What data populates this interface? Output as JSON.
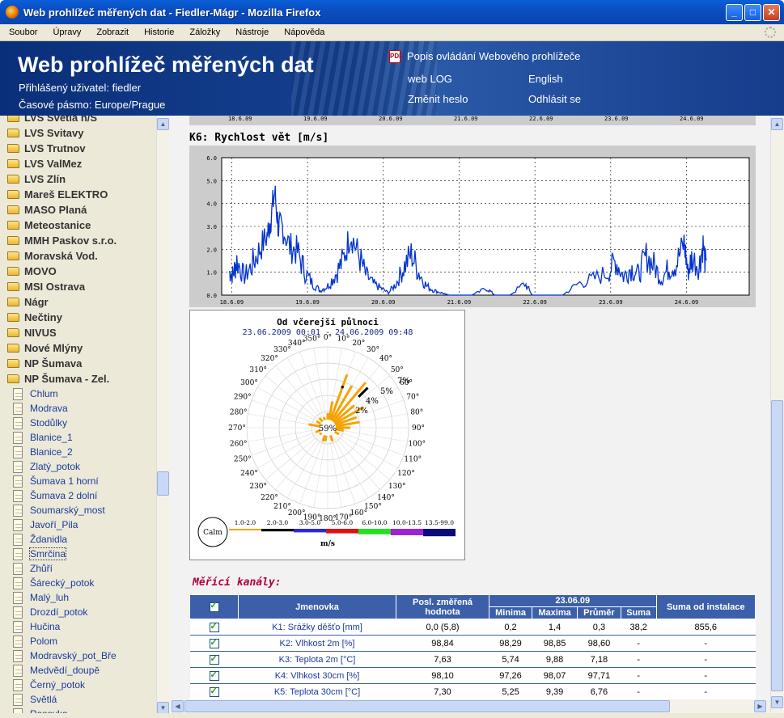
{
  "window": {
    "title": "Web prohlížeč měřených dat - Fiedler-Mágr - Mozilla Firefox"
  },
  "menu": [
    "Soubor",
    "Úpravy",
    "Zobrazit",
    "Historie",
    "Záložky",
    "Nástroje",
    "Nápověda"
  ],
  "header": {
    "title": "Web prohlížeč měřených dat",
    "user": "Přihlášený uživatel: fiedler",
    "timezone": "Časové pásmo: Europe/Prague",
    "pdf_link": "Popis ovládání Webového prohlížeče",
    "weblog": "web LOG",
    "english": "English",
    "change_password": "Změnit heslo",
    "logout": "Odhlásit se"
  },
  "sidebar": {
    "folders": [
      "LVS Světlá n/S",
      "LVS Svitavy",
      "LVS Trutnov",
      "LVS ValMez",
      "LVS Zlín",
      "Mareš ELEKTRO",
      "MASO Planá",
      "Meteostanice",
      "MMH Paskov s.r.o.",
      "Moravská Vod.",
      "MOVO",
      "MSI Ostrava",
      "Nágr",
      "Nečtiny",
      "NIVUS",
      "Nové Mlýny",
      "NP Šumava",
      "NP Šumava - Zel."
    ],
    "stations": [
      "Chlum",
      "Modrava",
      "Stodůlky",
      "Blanice_1",
      "Blanice_2",
      "Zlatý_potok",
      "Šumava 1 horní",
      "Šumava 2 dolní",
      "Soumarský_most",
      "Javoří_Pila",
      "Ždanidla",
      "Smrčina",
      "Zhůří",
      "Šárecký_potok",
      "Malý_luh",
      "Drozdí_potok",
      "Hučina",
      "Polom",
      "Modravský_pot_Bře",
      "Medvědí_doupě",
      "Černý_potok",
      "Světlá",
      "Rasovka"
    ],
    "selected": "Smrčina"
  },
  "chart_data": [
    {
      "type": "line",
      "title": "K6: Rychlost vět [m/s]",
      "x_ticks": [
        "18.6.09",
        "19.6.09",
        "20.6.09",
        "21.6.09",
        "22.6.09",
        "23.6.09",
        "24.6.09"
      ],
      "y_ticks": [
        "0.0",
        "1.0",
        "2.0",
        "3.0",
        "4.0",
        "5.0",
        "6.0"
      ],
      "ylim": [
        0,
        6
      ],
      "grid": true,
      "color": "#0033cc",
      "series": [
        {
          "values": [
            [
              0.0,
              1.0
            ],
            [
              0.05,
              0.9
            ],
            [
              0.1,
              1.5
            ],
            [
              0.2,
              0.8
            ],
            [
              0.3,
              1.3
            ],
            [
              0.4,
              2.0
            ],
            [
              0.5,
              2.6
            ],
            [
              0.55,
              3.4
            ],
            [
              0.6,
              4.5
            ],
            [
              0.65,
              2.9
            ],
            [
              0.7,
              3.0
            ],
            [
              0.8,
              2.1
            ],
            [
              0.9,
              1.9
            ],
            [
              1.0,
              1.0
            ],
            [
              1.1,
              0.5
            ],
            [
              1.2,
              0.2
            ],
            [
              1.3,
              0.4
            ],
            [
              1.4,
              0.9
            ],
            [
              1.5,
              1.5
            ],
            [
              1.6,
              2.7
            ],
            [
              1.7,
              1.8
            ],
            [
              1.8,
              0.9
            ],
            [
              1.9,
              0.5
            ],
            [
              2.0,
              0.3
            ],
            [
              2.1,
              0.1
            ],
            [
              2.2,
              0.5
            ],
            [
              2.3,
              1.2
            ],
            [
              2.4,
              1.8
            ],
            [
              2.5,
              1.0
            ],
            [
              2.6,
              0.4
            ],
            [
              2.7,
              0.2
            ],
            [
              2.8,
              0.1
            ],
            [
              2.9,
              0.0
            ],
            [
              3.0,
              0.0
            ],
            [
              3.2,
              0.0
            ],
            [
              3.4,
              0.3
            ],
            [
              3.5,
              0.0
            ],
            [
              3.7,
              0.0
            ],
            [
              3.9,
              0.5
            ],
            [
              4.0,
              0.0
            ],
            [
              4.2,
              0.0
            ],
            [
              4.4,
              0.0
            ],
            [
              4.6,
              0.5
            ],
            [
              4.8,
              0.7
            ],
            [
              5.0,
              1.0
            ],
            [
              5.1,
              1.5
            ],
            [
              5.2,
              0.8
            ],
            [
              5.3,
              1.2
            ],
            [
              5.4,
              0.9
            ],
            [
              5.5,
              1.7
            ],
            [
              5.6,
              1.3
            ],
            [
              5.7,
              0.7
            ],
            [
              5.8,
              1.2
            ],
            [
              5.9,
              1.4
            ],
            [
              6.0,
              2.3
            ],
            [
              6.05,
              1.0
            ],
            [
              6.1,
              1.6
            ],
            [
              6.2,
              1.3
            ],
            [
              6.25,
              2.2
            ],
            [
              6.3,
              0.9
            ]
          ]
        }
      ]
    },
    {
      "type": "rose",
      "title": "Od včerejší půlnoci",
      "subtitle": "23.06.2009 00:01 - 24.06.2009 09:48",
      "calm": "59%",
      "calm_label": "Calm",
      "rings": [
        "2%",
        "4%",
        "5%",
        "7%"
      ],
      "directions": [
        "0°",
        "10°",
        "20°",
        "30°",
        "40°",
        "50°",
        "60°",
        "70°",
        "80°",
        "90°",
        "100°",
        "110°",
        "120°",
        "130°",
        "140°",
        "150°",
        "160°",
        "170°",
        "180°",
        "190°",
        "200°",
        "210°",
        "220°",
        "230°",
        "240°",
        "250°",
        "260°",
        "270°",
        "280°",
        "290°",
        "300°",
        "310°",
        "320°",
        "330°",
        "340°",
        "350°"
      ],
      "legend": [
        "1.0-2.0",
        "2.0-3.0",
        "3.0-5.0",
        "5.0-6.0",
        "6.0-10.0",
        "10.0-13.5",
        "13.5-99.0"
      ],
      "legend_colors": [
        "#f5a300",
        "#000000",
        "#2a2ad8",
        "#e01010",
        "#22e022",
        "#9a22d8",
        "#0a0a7a"
      ],
      "unit": "m/s",
      "bars": [
        [
          0,
          1.0
        ],
        [
          10,
          2.5
        ],
        [
          20,
          6.2
        ],
        [
          30,
          5.2
        ],
        [
          40,
          6.5
        ],
        [
          50,
          3.5
        ],
        [
          60,
          4.3
        ],
        [
          70,
          3.0
        ],
        [
          80,
          3.2
        ],
        [
          90,
          2.0
        ],
        [
          100,
          1.2
        ],
        [
          120,
          0.8
        ],
        [
          160,
          1.0
        ],
        [
          190,
          0.9
        ],
        [
          200,
          1.0
        ],
        [
          230,
          0.5
        ],
        [
          250,
          0.8
        ],
        [
          280,
          1.6
        ],
        [
          300,
          0.8
        ],
        [
          320,
          0.8
        ],
        [
          340,
          0.6
        ]
      ]
    }
  ],
  "channels": {
    "title": "Měřící kanály:",
    "headers": {
      "name": "Jmenovka",
      "last": "Posl. změřená hodnota",
      "date": "23.06.09",
      "min": "Minima",
      "max": "Maxima",
      "avg": "Průměr",
      "sum": "Suma",
      "sum_total": "Suma od instalace"
    },
    "rows": [
      {
        "name": "K1: Srážky děšťo [mm]",
        "last": "0,0 (5,8)",
        "min": "0,2",
        "max": "1,4",
        "avg": "0,3",
        "sum": "38,2",
        "total": "855,6"
      },
      {
        "name": "K2: Vlhkost 2m [%]",
        "last": "98,84",
        "min": "98,29",
        "max": "98,85",
        "avg": "98,60",
        "sum": "-",
        "total": "-"
      },
      {
        "name": "K3: Teplota 2m [°C]",
        "last": "7,63",
        "min": "5,74",
        "max": "9,88",
        "avg": "7,18",
        "sum": "-",
        "total": "-"
      },
      {
        "name": "K4: Vlhkost 30cm [%]",
        "last": "98,10",
        "min": "97,26",
        "max": "98,07",
        "avg": "97,71",
        "sum": "-",
        "total": "-"
      },
      {
        "name": "K5: Teplota 30cm [°C]",
        "last": "7,30",
        "min": "5,25",
        "max": "9,39",
        "avg": "6,76",
        "sum": "-",
        "total": "-"
      }
    ]
  }
}
